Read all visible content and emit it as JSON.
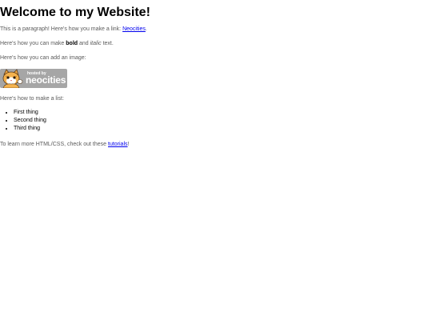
{
  "heading": "Welcome to my Website!",
  "para1": {
    "before": "This is a paragraph! Here's how you make a link: ",
    "link": "Neocities",
    "after": "."
  },
  "para2": {
    "before": "Here's how you can make ",
    "bold": "bold",
    "middle": " and ",
    "italic": "italic",
    "after": " text."
  },
  "para3": "Here's how you can add an image:",
  "image": {
    "small_text": "hosted by",
    "big_text": "neocities",
    "background": "#a6a6a6"
  },
  "para4": "Here's how to make a list:",
  "list": [
    "First thing",
    "Second thing",
    "Third thing"
  ],
  "para5": {
    "before": "To learn more HTML/CSS, check out these ",
    "link": "tutorials",
    "after": "!"
  },
  "colors": {
    "link": "#0000ee",
    "text": "#5b5b5b",
    "heading": "#000000"
  }
}
